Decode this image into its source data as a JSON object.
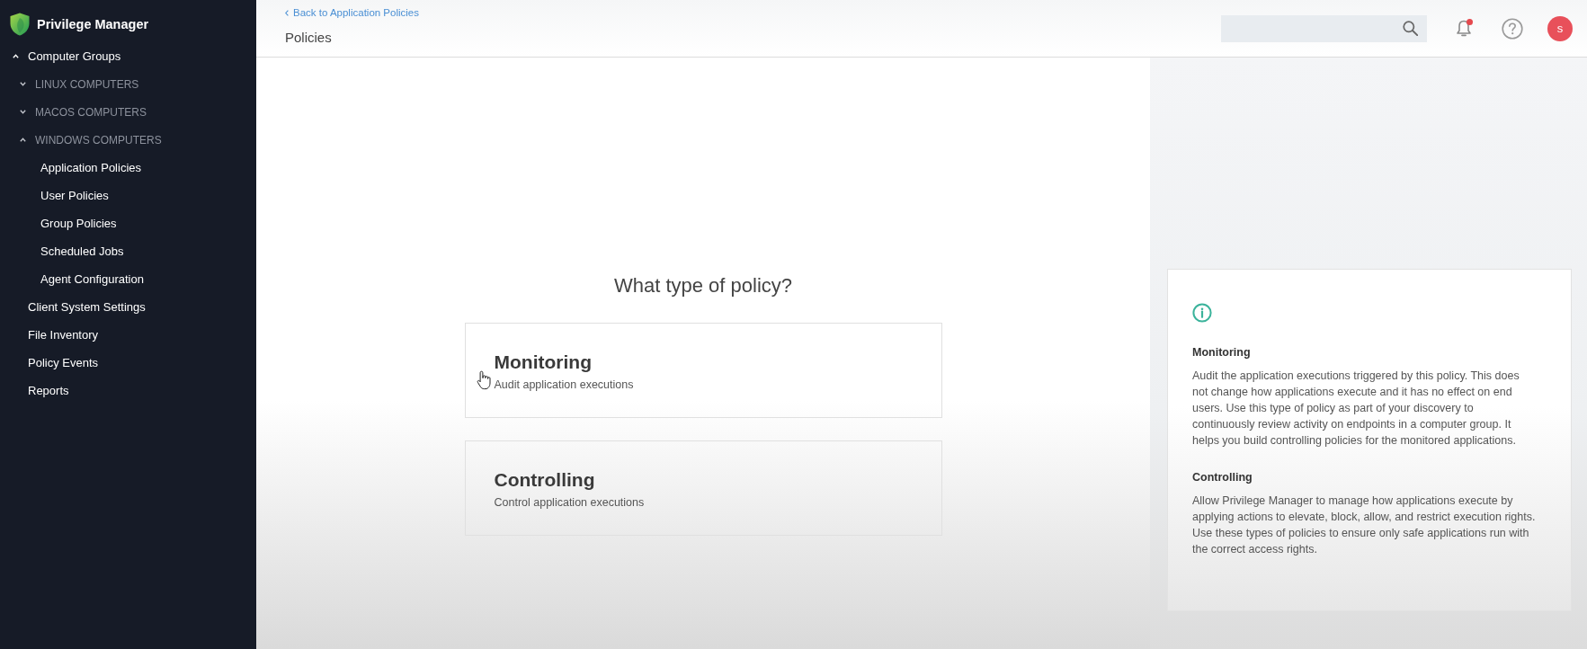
{
  "sidebar": {
    "title": "Privilege Manager",
    "items": [
      {
        "label": "Computer Groups",
        "expanded": true,
        "children": [
          {
            "label": "LINUX COMPUTERS",
            "expanded": false
          },
          {
            "label": "MACOS COMPUTERS",
            "expanded": false
          },
          {
            "label": "WINDOWS COMPUTERS",
            "expanded": true,
            "children": [
              {
                "label": "Application Policies"
              },
              {
                "label": "User Policies"
              },
              {
                "label": "Group Policies"
              },
              {
                "label": "Scheduled Jobs"
              },
              {
                "label": "Agent Configuration"
              }
            ]
          }
        ]
      },
      {
        "label": "Client System Settings"
      },
      {
        "label": "File Inventory"
      },
      {
        "label": "Policy Events"
      },
      {
        "label": "Reports"
      }
    ]
  },
  "header": {
    "back_link": "Back to Application Policies",
    "title": "Policies",
    "notifications": {
      "unread": true
    },
    "avatar": {
      "initial": "s"
    }
  },
  "main": {
    "question": "What type of policy?",
    "options": [
      {
        "title": "Monitoring",
        "description": "Audit application executions"
      },
      {
        "title": "Controlling",
        "description": "Control application executions"
      }
    ]
  },
  "info_panel": {
    "sections": [
      {
        "heading": "Monitoring",
        "text": "Audit the application executions triggered by this policy. This does not change how applications execute and it has no effect on end users. Use this type of policy as part of your discovery to continuously review activity on endpoints in a computer group. It helps you build controlling policies for the monitored applications."
      },
      {
        "heading": "Controlling",
        "text": "Allow Privilege Manager to manage how applications execute by applying actions to elevate, block, allow, and restrict execution rights. Use these types of policies to ensure only safe applications run with the correct access rights."
      }
    ]
  }
}
